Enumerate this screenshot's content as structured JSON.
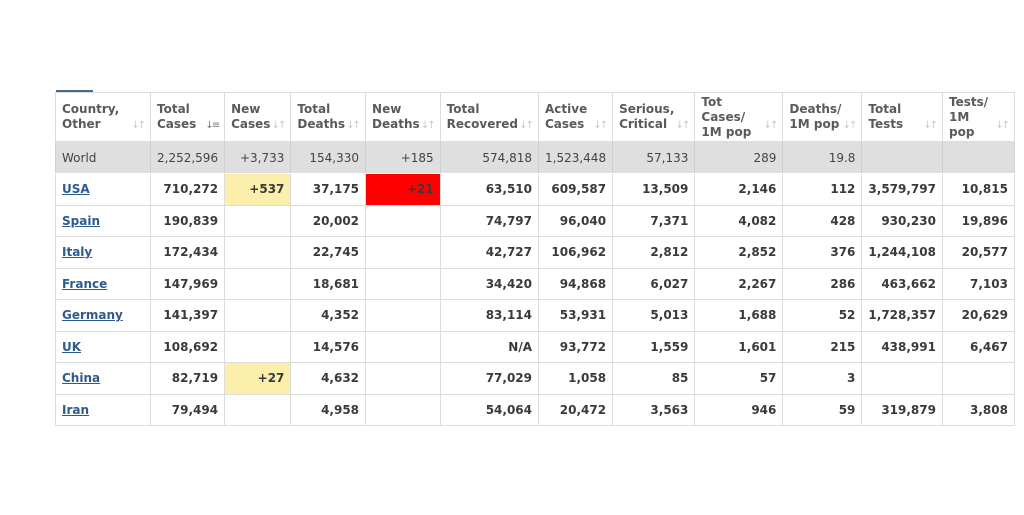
{
  "table": {
    "headers": [
      {
        "label": "Country,\nOther",
        "key": "country"
      },
      {
        "label": "Total\nCases",
        "key": "total_cases",
        "sorted": true
      },
      {
        "label": "New\nCases",
        "key": "new_cases"
      },
      {
        "label": "Total\nDeaths",
        "key": "total_deaths"
      },
      {
        "label": "New\nDeaths",
        "key": "new_deaths"
      },
      {
        "label": "Total\nRecovered",
        "key": "total_recovered"
      },
      {
        "label": "Active\nCases",
        "key": "active_cases"
      },
      {
        "label": "Serious,\nCritical",
        "key": "serious_critical"
      },
      {
        "label": "Tot Cases/\n1M pop",
        "key": "cases_per_1m"
      },
      {
        "label": "Deaths/\n1M pop",
        "key": "deaths_per_1m"
      },
      {
        "label": "Total\nTests",
        "key": "total_tests"
      },
      {
        "label": "Tests/\n1M pop",
        "key": "tests_per_1m"
      }
    ],
    "world": [
      "World",
      "2,252,596",
      "+3,733",
      "154,330",
      "+185",
      "574,818",
      "1,523,448",
      "57,133",
      "289",
      "19.8",
      "",
      ""
    ],
    "rows": [
      [
        "USA",
        "710,272",
        "+537",
        "37,175",
        "+21",
        "63,510",
        "609,587",
        "13,509",
        "2,146",
        "112",
        "3,579,797",
        "10,815"
      ],
      [
        "Spain",
        "190,839",
        "",
        "20,002",
        "",
        "74,797",
        "96,040",
        "7,371",
        "4,082",
        "428",
        "930,230",
        "19,896"
      ],
      [
        "Italy",
        "172,434",
        "",
        "22,745",
        "",
        "42,727",
        "106,962",
        "2,812",
        "2,852",
        "376",
        "1,244,108",
        "20,577"
      ],
      [
        "France",
        "147,969",
        "",
        "18,681",
        "",
        "34,420",
        "94,868",
        "6,027",
        "2,267",
        "286",
        "463,662",
        "7,103"
      ],
      [
        "Germany",
        "141,397",
        "",
        "4,352",
        "",
        "83,114",
        "53,931",
        "5,013",
        "1,688",
        "52",
        "1,728,357",
        "20,629"
      ],
      [
        "UK",
        "108,692",
        "",
        "14,576",
        "",
        "N/A",
        "93,772",
        "1,559",
        "1,601",
        "215",
        "438,991",
        "6,467"
      ],
      [
        "China",
        "82,719",
        "+27",
        "4,632",
        "",
        "77,029",
        "1,058",
        "85",
        "57",
        "3",
        "",
        ""
      ],
      [
        "Iran",
        "79,494",
        "",
        "4,958",
        "",
        "54,064",
        "20,472",
        "3,563",
        "946",
        "59",
        "319,879",
        "3,808"
      ]
    ]
  },
  "colors": {
    "new_cases_highlight": "#fceeab",
    "new_deaths_highlight": "#ff0000",
    "world_row_bg": "#dfdfdf",
    "country_link": "#2f5a8f"
  },
  "icons": {
    "sort": "sort-arrows-icon",
    "sort_active": "sort-descending-icon"
  }
}
